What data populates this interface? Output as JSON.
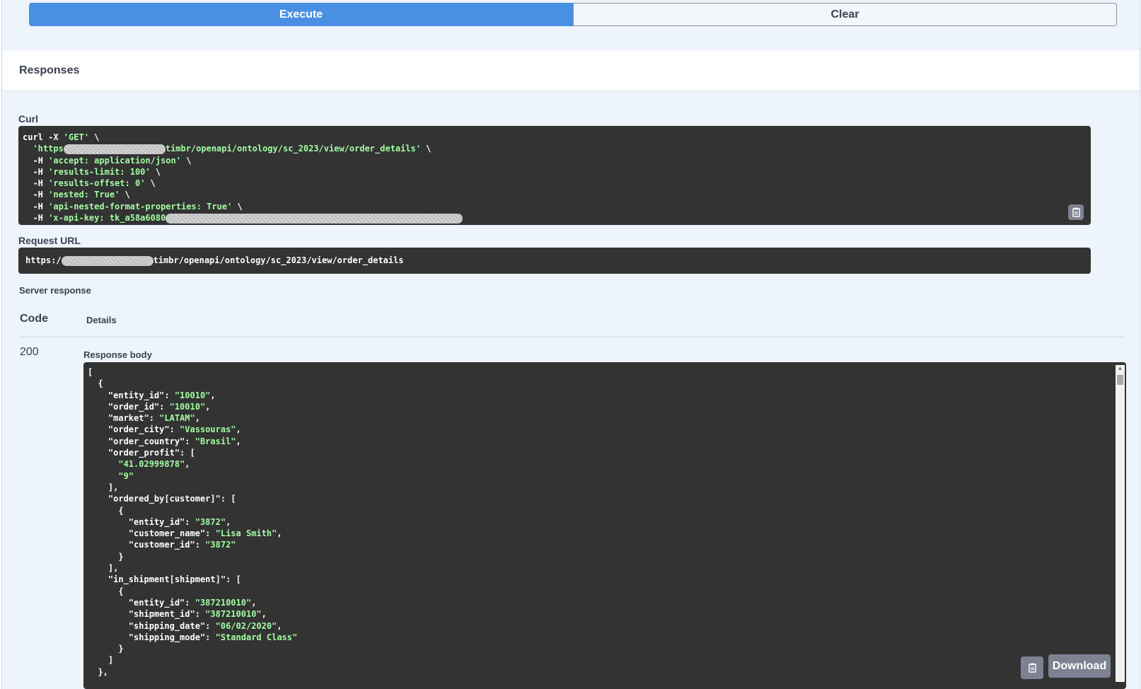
{
  "buttons": {
    "execute": "Execute",
    "clear": "Clear"
  },
  "responses": {
    "title": "Responses"
  },
  "curl": {
    "label": "Curl",
    "line1_a": "curl -X ",
    "line1_b": "'GET'",
    "line1_c": " \\",
    "line2_a": "'https",
    "line2_b": "timbr/openapi/ontology/sc_2023/view/order_details'",
    "line2_c": " \\",
    "h1": "'accept: application/json'",
    "h2": "'results-limit: 100'",
    "h3": "'results-offset: 0'",
    "h4": "'nested: True'",
    "h5": "'api-nested-format-properties: True'",
    "h6": "'x-api-key: tk_a58a6080",
    "flag": "  -H ",
    "cont": " \\"
  },
  "request_url": {
    "label": "Request URL",
    "prefix": "https:/",
    "suffix": "timbr/openapi/ontology/sc_2023/view/order_details"
  },
  "server_response": {
    "label": "Server response",
    "code_header": "Code",
    "details_header": "Details",
    "code": "200",
    "body_label": "Response body",
    "download": "Download"
  },
  "body": {
    "open_bracket": "[",
    "open_brace": "  {",
    "entity_id_key": "    \"entity_id\": ",
    "entity_id_val": "\"10010\"",
    "order_id_key": "    \"order_id\": ",
    "order_id_val": "\"10010\"",
    "market_key": "    \"market\": ",
    "market_val": "\"LATAM\"",
    "city_key": "    \"order_city\": ",
    "city_val": "\"Vassouras\"",
    "country_key": "    \"order_country\": ",
    "country_val": "\"Brasil\"",
    "profit_key": "    \"order_profit\": [",
    "profit_v1": "\"41.02999878\"",
    "profit_v2": "\"9\"",
    "close_arr": "    ],",
    "ordered_by_key": "    \"ordered_by[customer]\": [",
    "inner_open": "      {",
    "c_entity_key": "        \"entity_id\": ",
    "c_entity_val": "\"3872\"",
    "c_name_key": "        \"customer_name\": ",
    "c_name_val": "\"Lisa Smith\"",
    "c_id_key": "        \"customer_id\": ",
    "c_id_val": "\"3872\"",
    "inner_close": "      }",
    "in_shipment_key": "    \"in_shipment[shipment]\": [",
    "s_entity_key": "        \"entity_id\": ",
    "s_entity_val": "\"387210010\"",
    "s_id_key": "        \"shipment_id\": ",
    "s_id_val": "\"387210010\"",
    "s_date_key": "        \"shipping_date\": ",
    "s_date_val": "\"06/02/2020\"",
    "s_mode_key": "        \"shipping_mode\": ",
    "s_mode_val": "\"Standard Class\"",
    "close_arr_last": "    ]",
    "close_brace": "  },"
  }
}
